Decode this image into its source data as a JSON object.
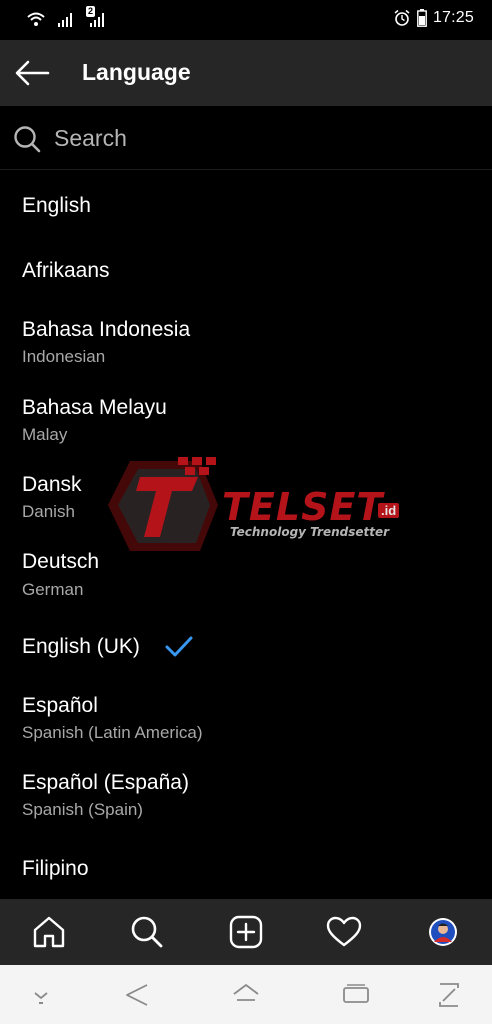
{
  "status_bar": {
    "time": "17:25",
    "sim_badge": "2",
    "icons": [
      "wifi-icon",
      "signal-icon",
      "signal-sim2-icon",
      "alarm-icon",
      "battery-icon"
    ]
  },
  "header": {
    "title": "Language",
    "back_icon": "arrow-left-icon"
  },
  "search": {
    "placeholder": "Search",
    "value": ""
  },
  "languages": [
    {
      "name": "English",
      "sub": ""
    },
    {
      "name": "Afrikaans",
      "sub": ""
    },
    {
      "name": "Bahasa Indonesia",
      "sub": "Indonesian"
    },
    {
      "name": "Bahasa Melayu",
      "sub": "Malay"
    },
    {
      "name": "Dansk",
      "sub": "Danish"
    },
    {
      "name": "Deutsch",
      "sub": "German"
    },
    {
      "name": "English (UK)",
      "sub": "",
      "selected": true
    },
    {
      "name": "Español",
      "sub": "Spanish (Latin America)"
    },
    {
      "name": "Español (España)",
      "sub": "Spanish (Spain)"
    },
    {
      "name": "Filipino",
      "sub": ""
    }
  ],
  "watermark": {
    "brand": "TELSET",
    "suffix": ".id",
    "tagline": "Technology Trendsetter"
  },
  "bottom_nav": [
    "home-icon",
    "search-icon",
    "add-post-icon",
    "heart-icon",
    "profile-avatar"
  ],
  "system_nav": [
    "collapse-icon",
    "back-triangle-icon",
    "home-outline-icon",
    "recents-icon",
    "fullscreen-icon"
  ],
  "colors": {
    "background": "#000000",
    "header_bg": "#262626",
    "accent_check": "#3897f0",
    "secondary_text": "#a8a8a8",
    "watermark_red": "#c8161d"
  }
}
